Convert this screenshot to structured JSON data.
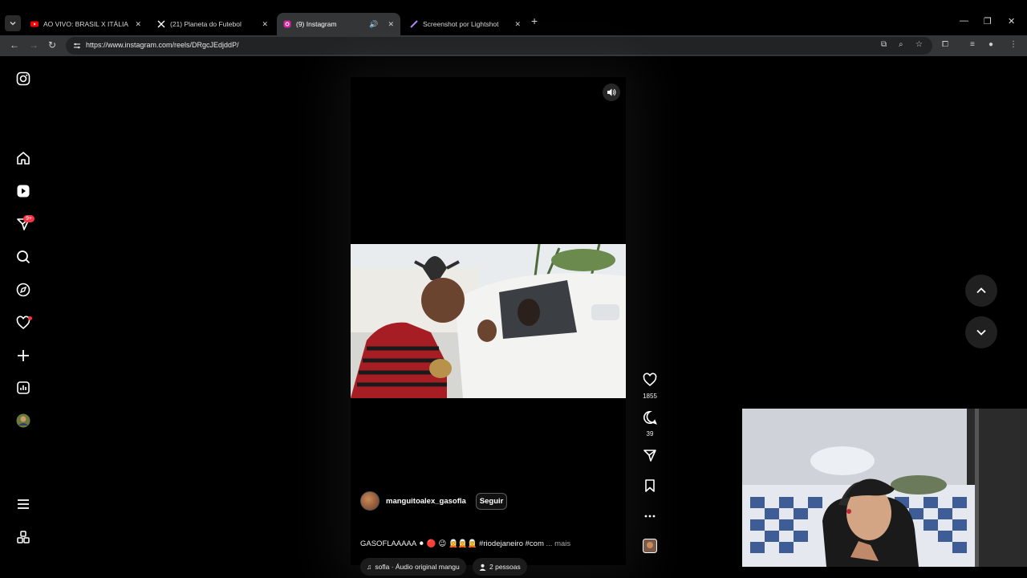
{
  "browser": {
    "tabs": [
      {
        "title": "AO VIVO: BRASIL X ITÁLIA | CO",
        "icon": "youtube-icon",
        "active": false
      },
      {
        "title": "(21) Planeta do Futebol",
        "icon": "x-icon",
        "active": false
      },
      {
        "title": "(9) Instagram",
        "icon": "instagram-icon",
        "active": true
      },
      {
        "title": "Screenshot por Lightshot",
        "icon": "lightshot-icon",
        "active": false
      }
    ],
    "url": "https://www.instagram.com/reels/DRgcJEdjddP/"
  },
  "sidebar": {
    "notifications_badge": "9+",
    "items": [
      "instagram-logo-icon",
      "home-icon",
      "reels-icon",
      "messages-icon",
      "search-icon",
      "explore-icon",
      "notifications-icon",
      "create-icon",
      "dashboard-icon",
      "profile-avatar"
    ]
  },
  "reel": {
    "author": "manguitoalex_gasofla",
    "follow_label": "Seguir",
    "caption_text": "GASOFLAAAAA ⚫ 🔴 😉 🧝🧝🧝 #riodejaneiro #com",
    "caption_more": "... mais",
    "audio_label": "sofla · Áudio original  mangu",
    "people_label": "2 pessoas",
    "likes": "1855",
    "comments": "39"
  },
  "colors": {
    "accent_red": "#ff3040",
    "chrome_bg": "#333536",
    "page_bg": "#000000"
  }
}
